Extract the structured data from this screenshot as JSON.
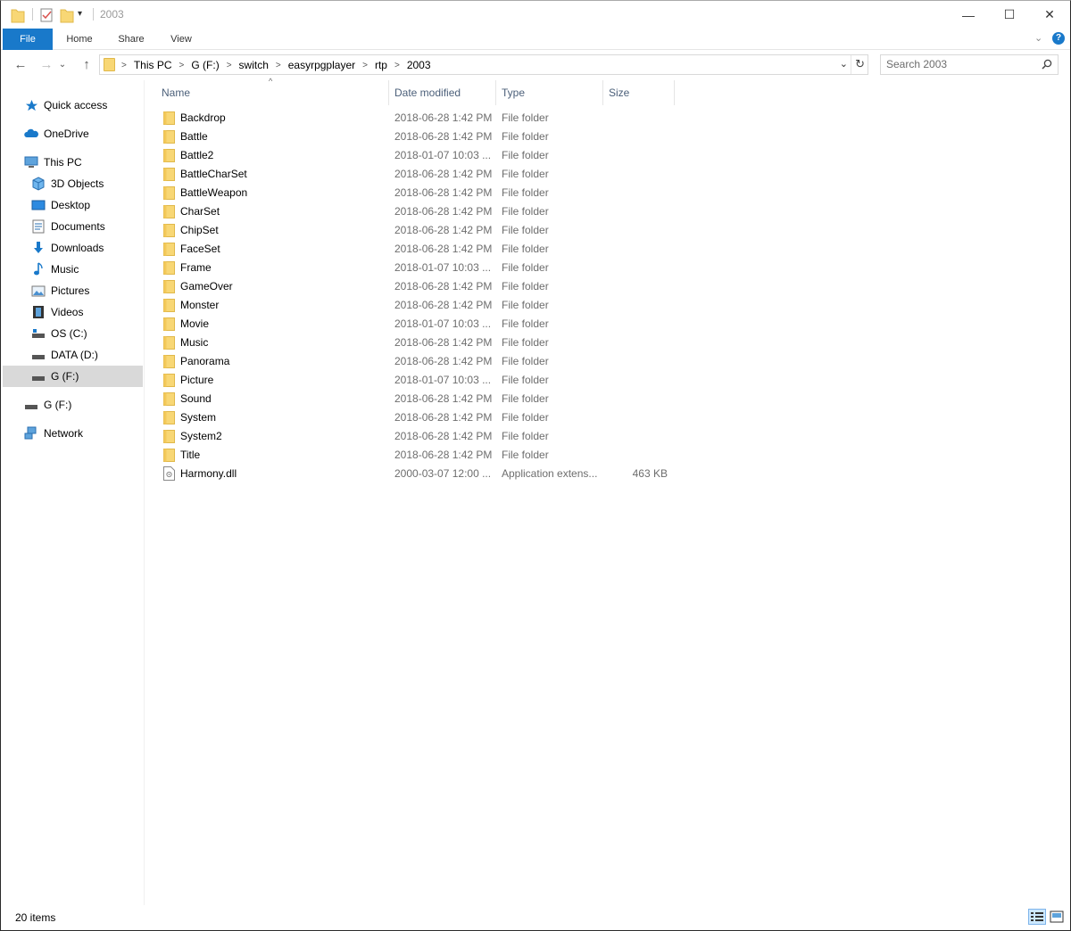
{
  "titlebar": {
    "title": "2003",
    "minimize_glyph": "—",
    "maximize_glyph": "☐",
    "close_glyph": "✕"
  },
  "ribbon": {
    "tabs": [
      "File",
      "Home",
      "Share",
      "View"
    ],
    "expand_glyph": "⌄",
    "help_glyph": "?"
  },
  "nav": {
    "back_glyph": "←",
    "forward_glyph": "→",
    "recent_glyph": "⌄",
    "up_glyph": "↑"
  },
  "address": {
    "crumbs": [
      "This PC",
      "G (F:)",
      "switch",
      "easyrpgplayer",
      "rtp",
      "2003"
    ],
    "separator": ">",
    "dropdown_glyph": "⌄",
    "refresh_glyph": "↻"
  },
  "search": {
    "placeholder": "Search 2003"
  },
  "sidebar": {
    "items": [
      {
        "label": "Quick access",
        "icon": "star-icon"
      },
      {
        "label": "OneDrive",
        "icon": "cloud-icon"
      },
      {
        "label": "This PC",
        "icon": "computer-icon"
      },
      {
        "label": "3D Objects",
        "icon": "cube-icon"
      },
      {
        "label": "Desktop",
        "icon": "desktop-icon"
      },
      {
        "label": "Documents",
        "icon": "document-icon"
      },
      {
        "label": "Downloads",
        "icon": "download-icon"
      },
      {
        "label": "Music",
        "icon": "music-icon"
      },
      {
        "label": "Pictures",
        "icon": "picture-icon"
      },
      {
        "label": "Videos",
        "icon": "video-icon"
      },
      {
        "label": "OS (C:)",
        "icon": "drive-icon"
      },
      {
        "label": "DATA (D:)",
        "icon": "drive-icon"
      },
      {
        "label": "G (F:)",
        "icon": "drive-icon",
        "selected": true
      },
      {
        "label": "G (F:)",
        "icon": "drive-icon"
      },
      {
        "label": "Network",
        "icon": "network-icon"
      }
    ]
  },
  "columns": [
    "Name",
    "Date modified",
    "Type",
    "Size"
  ],
  "sort_glyph": "^",
  "files": [
    {
      "name": "Backdrop",
      "date": "2018-06-28 1:42 PM",
      "type": "File folder",
      "size": "",
      "kind": "folder"
    },
    {
      "name": "Battle",
      "date": "2018-06-28 1:42 PM",
      "type": "File folder",
      "size": "",
      "kind": "folder"
    },
    {
      "name": "Battle2",
      "date": "2018-01-07 10:03 ...",
      "type": "File folder",
      "size": "",
      "kind": "folder"
    },
    {
      "name": "BattleCharSet",
      "date": "2018-06-28 1:42 PM",
      "type": "File folder",
      "size": "",
      "kind": "folder"
    },
    {
      "name": "BattleWeapon",
      "date": "2018-06-28 1:42 PM",
      "type": "File folder",
      "size": "",
      "kind": "folder"
    },
    {
      "name": "CharSet",
      "date": "2018-06-28 1:42 PM",
      "type": "File folder",
      "size": "",
      "kind": "folder"
    },
    {
      "name": "ChipSet",
      "date": "2018-06-28 1:42 PM",
      "type": "File folder",
      "size": "",
      "kind": "folder"
    },
    {
      "name": "FaceSet",
      "date": "2018-06-28 1:42 PM",
      "type": "File folder",
      "size": "",
      "kind": "folder"
    },
    {
      "name": "Frame",
      "date": "2018-01-07 10:03 ...",
      "type": "File folder",
      "size": "",
      "kind": "folder"
    },
    {
      "name": "GameOver",
      "date": "2018-06-28 1:42 PM",
      "type": "File folder",
      "size": "",
      "kind": "folder"
    },
    {
      "name": "Monster",
      "date": "2018-06-28 1:42 PM",
      "type": "File folder",
      "size": "",
      "kind": "folder"
    },
    {
      "name": "Movie",
      "date": "2018-01-07 10:03 ...",
      "type": "File folder",
      "size": "",
      "kind": "folder"
    },
    {
      "name": "Music",
      "date": "2018-06-28 1:42 PM",
      "type": "File folder",
      "size": "",
      "kind": "folder"
    },
    {
      "name": "Panorama",
      "date": "2018-06-28 1:42 PM",
      "type": "File folder",
      "size": "",
      "kind": "folder"
    },
    {
      "name": "Picture",
      "date": "2018-01-07 10:03 ...",
      "type": "File folder",
      "size": "",
      "kind": "folder"
    },
    {
      "name": "Sound",
      "date": "2018-06-28 1:42 PM",
      "type": "File folder",
      "size": "",
      "kind": "folder"
    },
    {
      "name": "System",
      "date": "2018-06-28 1:42 PM",
      "type": "File folder",
      "size": "",
      "kind": "folder"
    },
    {
      "name": "System2",
      "date": "2018-06-28 1:42 PM",
      "type": "File folder",
      "size": "",
      "kind": "folder"
    },
    {
      "name": "Title",
      "date": "2018-06-28 1:42 PM",
      "type": "File folder",
      "size": "",
      "kind": "folder"
    },
    {
      "name": "Harmony.dll",
      "date": "2000-03-07 12:00 ...",
      "type": "Application extens...",
      "size": "463 KB",
      "kind": "dll"
    }
  ],
  "status": {
    "item_count": "20 items"
  },
  "colors": {
    "accent": "#1979ca",
    "folder": "#f8d775",
    "selection": "#d9d9d9",
    "header_text": "#4c607a"
  }
}
